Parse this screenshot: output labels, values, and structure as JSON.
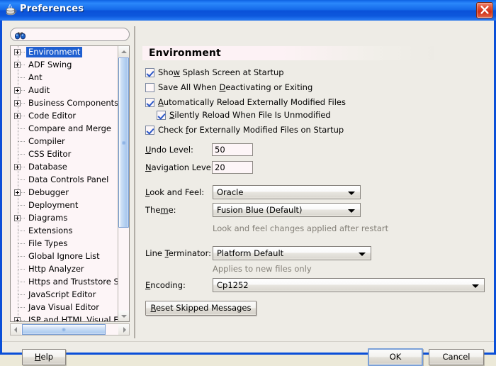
{
  "window": {
    "title": "Preferences",
    "icon": "java-coffee-cup-icon",
    "close_label": "×",
    "border_color": "#0a4fd8",
    "titlebar_color": "#1c73f0"
  },
  "search": {
    "placeholder": "",
    "value": "",
    "icon": "binoculars-icon"
  },
  "tree": {
    "items": [
      {
        "label": "Environment",
        "expandable": true,
        "selected": true
      },
      {
        "label": "ADF Swing",
        "expandable": true,
        "selected": false
      },
      {
        "label": "Ant",
        "expandable": false,
        "selected": false
      },
      {
        "label": "Audit",
        "expandable": true,
        "selected": false
      },
      {
        "label": "Business Components",
        "expandable": true,
        "selected": false
      },
      {
        "label": "Code Editor",
        "expandable": true,
        "selected": false
      },
      {
        "label": "Compare and Merge",
        "expandable": false,
        "selected": false
      },
      {
        "label": "Compiler",
        "expandable": false,
        "selected": false
      },
      {
        "label": "CSS Editor",
        "expandable": false,
        "selected": false
      },
      {
        "label": "Database",
        "expandable": true,
        "selected": false
      },
      {
        "label": "Data Controls Panel",
        "expandable": false,
        "selected": false
      },
      {
        "label": "Debugger",
        "expandable": true,
        "selected": false
      },
      {
        "label": "Deployment",
        "expandable": false,
        "selected": false
      },
      {
        "label": "Diagrams",
        "expandable": true,
        "selected": false
      },
      {
        "label": "Extensions",
        "expandable": false,
        "selected": false
      },
      {
        "label": "File Types",
        "expandable": false,
        "selected": false
      },
      {
        "label": "Global Ignore List",
        "expandable": false,
        "selected": false
      },
      {
        "label": "Http Analyzer",
        "expandable": false,
        "selected": false
      },
      {
        "label": "Https and Truststore Settin",
        "expandable": false,
        "selected": false
      },
      {
        "label": "JavaScript Editor",
        "expandable": false,
        "selected": false
      },
      {
        "label": "Java Visual Editor",
        "expandable": false,
        "selected": false
      },
      {
        "label": "JSP and HTML Visual Editor",
        "expandable": true,
        "selected": false
      }
    ]
  },
  "panel": {
    "header": "Environment",
    "checkboxes": [
      {
        "label_before": "Sho",
        "mnemonic": "w",
        "label_after": " Splash Screen at Startup",
        "checked": true,
        "indent": false
      },
      {
        "label_before": "Save All When ",
        "mnemonic": "D",
        "label_after": "eactivating or Exiting",
        "checked": false,
        "indent": false
      },
      {
        "label_before": "",
        "mnemonic": "A",
        "label_after": "utomatically Reload Externally Modified Files",
        "checked": true,
        "indent": false
      },
      {
        "label_before": "",
        "mnemonic": "S",
        "label_after": "ilently Reload When File Is Unmodified",
        "checked": true,
        "indent": true
      },
      {
        "label_before": "Check ",
        "mnemonic": "f",
        "label_after": "or Externally Modified Files on Startup",
        "checked": true,
        "indent": false
      }
    ],
    "undo": {
      "label_before": "",
      "mnemonic": "U",
      "label_after": "ndo Level:",
      "value": "50"
    },
    "navigation": {
      "label_before": "",
      "mnemonic": "N",
      "label_after": "avigation Level:",
      "value": "20"
    },
    "look_and_feel": {
      "label_before": "",
      "mnemonic": "L",
      "label_after": "ook and Feel:",
      "value": "Oracle"
    },
    "theme": {
      "label_before": "The",
      "mnemonic": "m",
      "label_after": "e:",
      "value": "Fusion Blue (Default)"
    },
    "theme_hint": "Look and feel changes applied after restart",
    "line_terminator": {
      "label_before": "Line ",
      "mnemonic": "T",
      "label_after": "erminator:",
      "value": "Platform Default"
    },
    "line_terminator_hint": "Applies to new files only",
    "encoding": {
      "label_before": "",
      "mnemonic": "E",
      "label_after": "ncoding:",
      "value": "Cp1252"
    },
    "reset_button": {
      "label_before": "",
      "mnemonic": "R",
      "label_after": "eset Skipped Messages"
    }
  },
  "buttons": {
    "help": {
      "label_before": "",
      "mnemonic": "H",
      "label_after": "elp"
    },
    "ok": {
      "label": "OK",
      "is_default": true
    },
    "cancel": {
      "label": "Cancel",
      "is_default": false
    }
  }
}
